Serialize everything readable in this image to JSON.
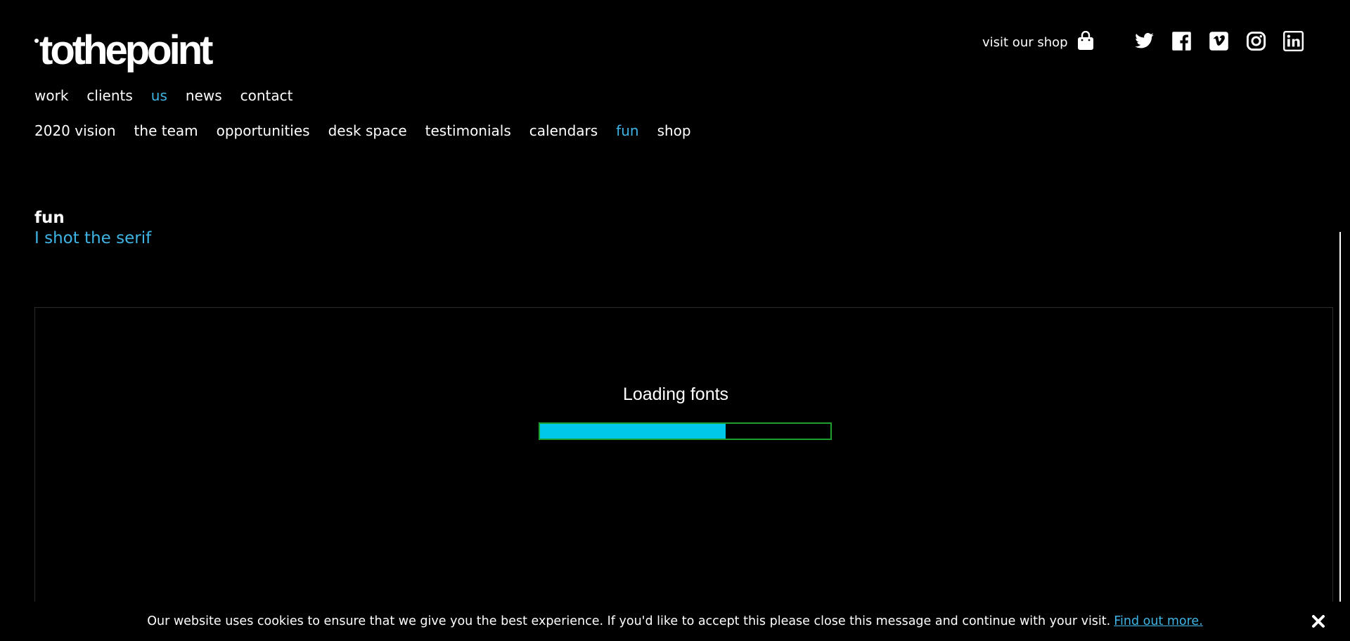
{
  "brand": {
    "logo_text": "tothepoint"
  },
  "header": {
    "shop_label": "visit our shop",
    "shop_icon": "shopping-bag-icon",
    "social": [
      {
        "name": "twitter",
        "icon": "twitter-icon"
      },
      {
        "name": "facebook",
        "icon": "facebook-icon"
      },
      {
        "name": "vimeo",
        "icon": "vimeo-icon"
      },
      {
        "name": "instagram",
        "icon": "instagram-icon"
      },
      {
        "name": "linkedin",
        "icon": "linkedin-icon"
      }
    ]
  },
  "nav_primary": [
    {
      "label": "work",
      "active": false
    },
    {
      "label": "clients",
      "active": false
    },
    {
      "label": "us",
      "active": true
    },
    {
      "label": "news",
      "active": false
    },
    {
      "label": "contact",
      "active": false
    }
  ],
  "nav_secondary": [
    {
      "label": "2020 vision",
      "active": false
    },
    {
      "label": "the team",
      "active": false
    },
    {
      "label": "opportunities",
      "active": false
    },
    {
      "label": "desk space",
      "active": false
    },
    {
      "label": "testimonials",
      "active": false
    },
    {
      "label": "calendars",
      "active": false
    },
    {
      "label": "fun",
      "active": true
    },
    {
      "label": "shop",
      "active": false
    }
  ],
  "content": {
    "title": "fun",
    "subtitle": "I shot the serif"
  },
  "loader": {
    "text": "Loading fonts",
    "progress_fraction": 0.64,
    "fill_color": "#00c8e8",
    "border_color": "#1c9f2c"
  },
  "cookie": {
    "message": "Our website uses cookies to ensure that we give you the best experience. If you'd like to accept this please close this message and continue with your visit.",
    "link_label": "Find out more.",
    "close_icon": "close-icon"
  },
  "colors": {
    "background": "#000000",
    "text": "#ffffff",
    "accent": "#3fb4e5"
  }
}
